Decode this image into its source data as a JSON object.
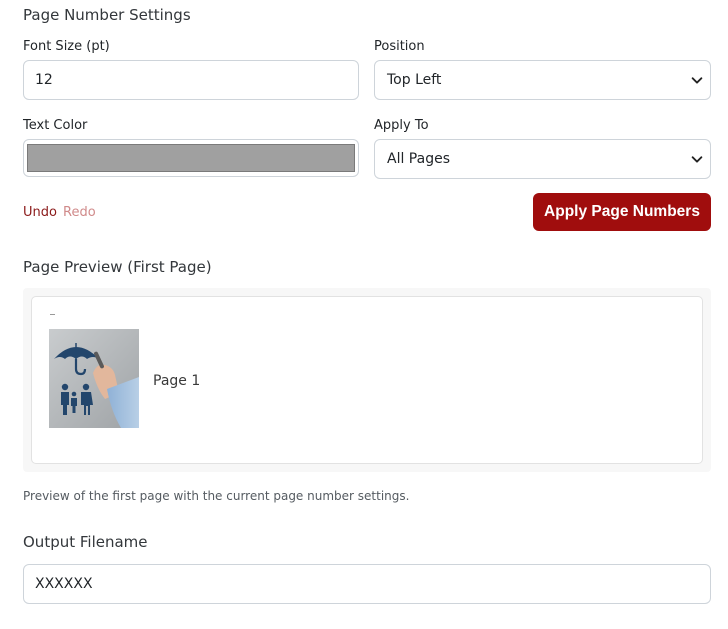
{
  "settings": {
    "title": "Page Number Settings",
    "font_size": {
      "label": "Font Size (pt)",
      "value": "12"
    },
    "position": {
      "label": "Position",
      "selected": "Top Left"
    },
    "text_color": {
      "label": "Text Color",
      "value": "#a0a0a0"
    },
    "apply_to": {
      "label": "Apply To",
      "selected": "All Pages"
    },
    "undo_label": "Undo",
    "redo_label": "Redo",
    "apply_button": "Apply Page Numbers"
  },
  "preview": {
    "title": "Page Preview (First Page)",
    "page_label": "Page 1",
    "help_text": "Preview of the first page with the current page number settings."
  },
  "output": {
    "title": "Output Filename",
    "value": "XXXXXX"
  },
  "colors": {
    "accent": "#a00d0d",
    "redo_disabled": "#d08a8a"
  },
  "icons": {
    "select_caret": "chevron-down-icon"
  }
}
